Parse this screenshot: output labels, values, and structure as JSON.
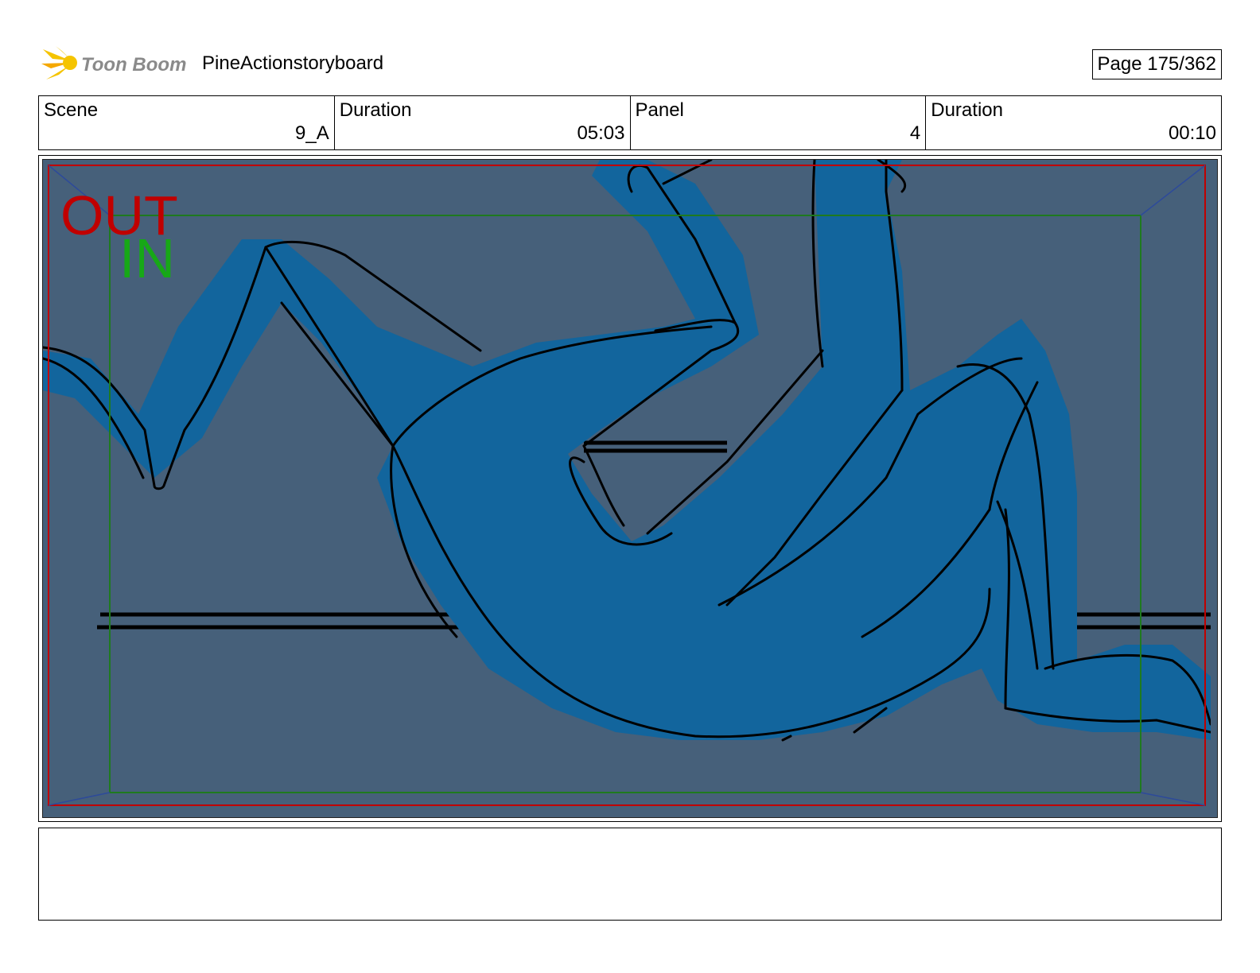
{
  "header": {
    "logo_text": "Toon Boom",
    "project_title": "PineActionstoryboard",
    "page_label": "Page 175/362"
  },
  "info": [
    {
      "label": "Scene",
      "value": "9_A"
    },
    {
      "label": "Duration",
      "value": "05:03"
    },
    {
      "label": "Panel",
      "value": "4"
    },
    {
      "label": "Duration",
      "value": "00:10"
    }
  ],
  "panel": {
    "out_label": "OUT",
    "in_label": "IN",
    "colors": {
      "background": "#46607a",
      "figure": "#12659d",
      "out_frame": "#c00000",
      "in_frame": "#1f7a1f",
      "in_text": "#17a817",
      "out_text": "#c00000"
    }
  },
  "notes": ""
}
